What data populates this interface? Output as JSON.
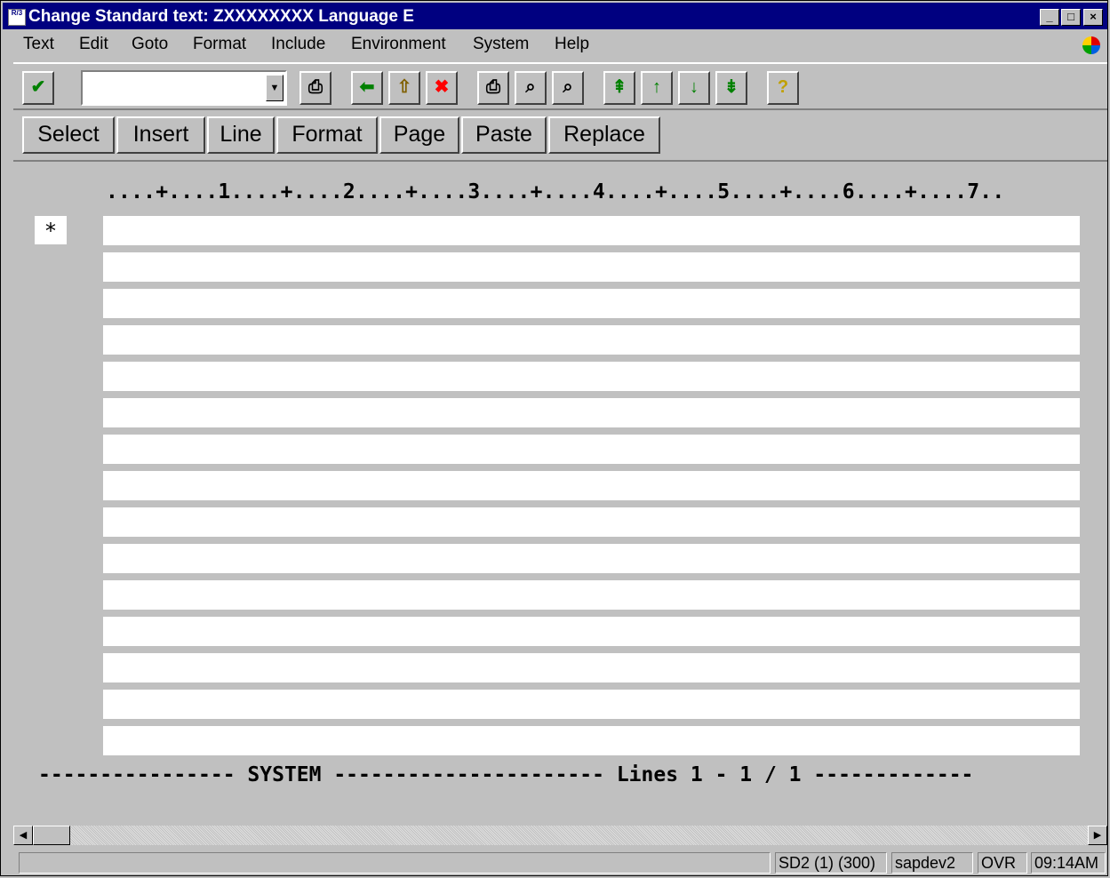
{
  "window": {
    "app_icon_text": "R/3",
    "title": "Change Standard text: ZXXXXXXXX Language E",
    "controls": {
      "minimize": "_",
      "maximize": "□",
      "close": "×"
    }
  },
  "menu": {
    "items": [
      {
        "label": "Text"
      },
      {
        "label": "Edit"
      },
      {
        "label": "Goto"
      },
      {
        "label": "Format"
      },
      {
        "label": "Include"
      },
      {
        "label": "Environment"
      },
      {
        "label": "System"
      },
      {
        "label": "Help"
      }
    ]
  },
  "toolbar": {
    "command_field_value": "",
    "icons": [
      "checkmark-icon",
      "save-icon",
      "back-icon",
      "exit-icon",
      "cancel-icon",
      "print-icon",
      "find-icon",
      "find-next-icon",
      "first-page-icon",
      "previous-page-icon",
      "next-page-icon",
      "last-page-icon",
      "help-icon"
    ],
    "colors": {
      "check": "#008000",
      "back": "#008000",
      "cancel": "#ff0000",
      "help": "#ffff00"
    }
  },
  "app_toolbar": {
    "buttons": [
      {
        "label": "Select"
      },
      {
        "label": "Insert"
      },
      {
        "label": "Line"
      },
      {
        "label": "Format"
      },
      {
        "label": "Page"
      },
      {
        "label": "Paste"
      },
      {
        "label": "Replace"
      }
    ]
  },
  "editor": {
    "ruler": "....+....1....+....2....+....3....+....4....+....5....+....6....+....7..",
    "format_marker": "*",
    "lines": [
      "",
      "",
      "",
      "",
      "",
      "",
      "",
      "",
      "",
      "",
      "",
      "",
      "",
      "",
      ""
    ],
    "footer": "---------------- SYSTEM ---------------------- Lines 1 - 1 / 1 -------------"
  },
  "status": {
    "message": "",
    "system": "SD2 (1) (300)",
    "server": "sapdev2",
    "mode": "OVR",
    "time": "09:14AM"
  }
}
